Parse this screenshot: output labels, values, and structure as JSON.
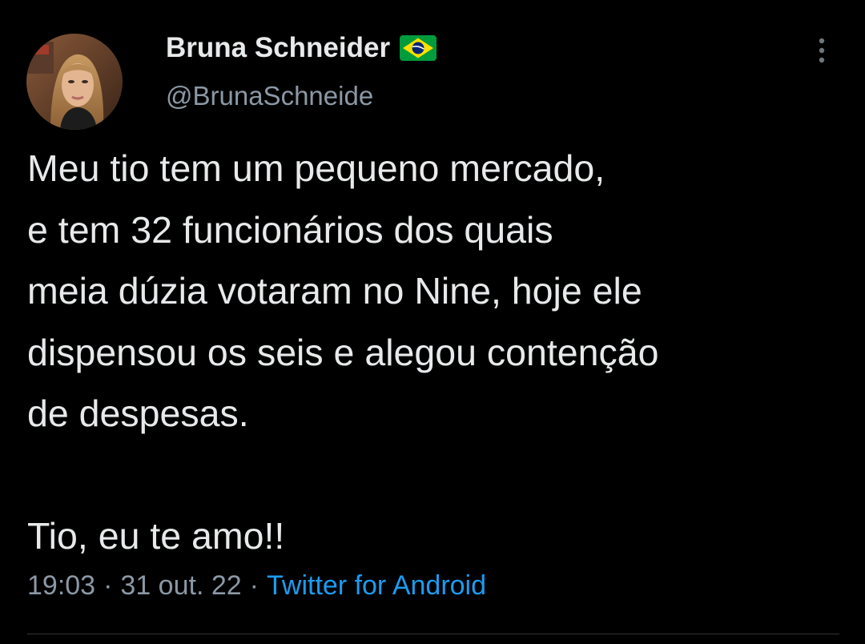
{
  "author": {
    "display_name": "Bruna Schneider",
    "handle": "@BrunaSchneide",
    "flag_icon": "brazil-flag-icon"
  },
  "tweet": {
    "text": "Meu tio tem um pequeno mercado,\ne tem 32 funcionários dos quais\nmeia dúzia votaram no Nine, hoje ele\ndispensou os seis e alegou contenção\nde despesas.\n\nTio, eu te amo!!"
  },
  "meta": {
    "time": "19:03",
    "separator": "·",
    "date": "31 out. 22",
    "source": "Twitter for Android"
  },
  "icons": {
    "more": "more-vertical-icon"
  },
  "colors": {
    "background": "#000000",
    "text_primary": "#e7e9ea",
    "text_secondary": "#8b98a5",
    "link": "#1d9bf0",
    "divider": "#2f3336"
  }
}
